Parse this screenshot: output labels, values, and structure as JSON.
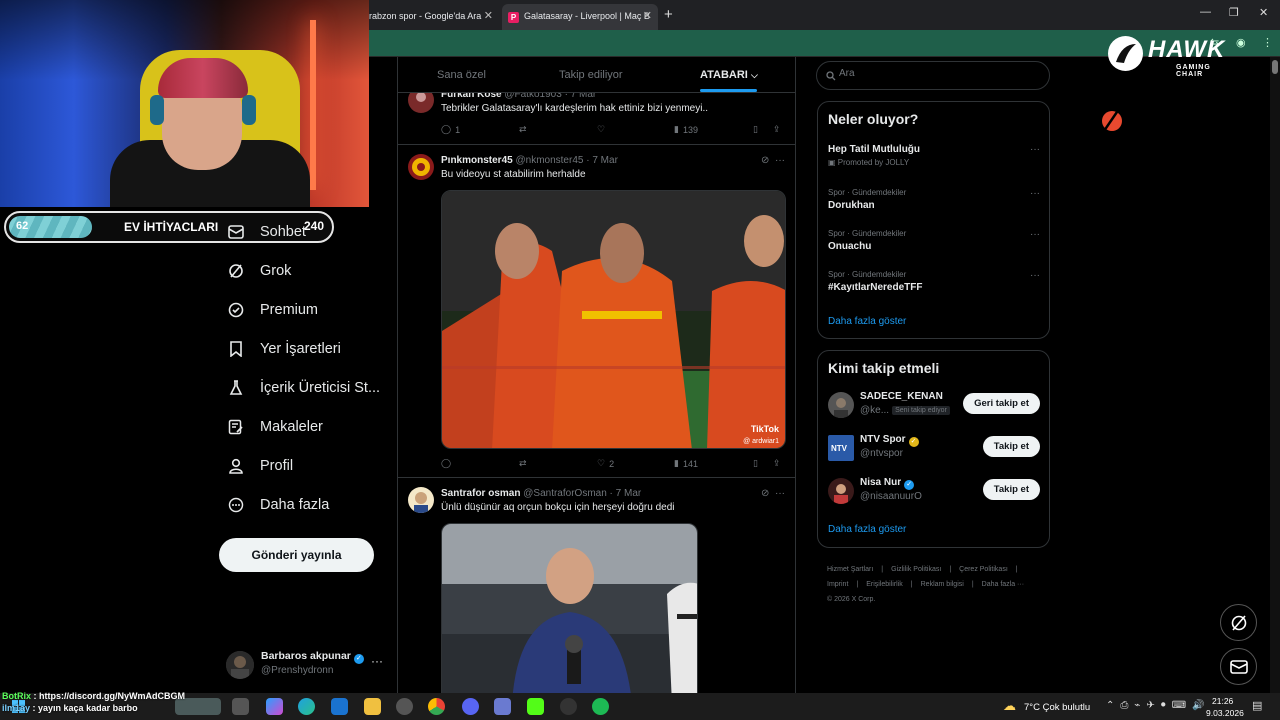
{
  "browser": {
    "tabs": [
      {
        "title": "rabzon spor - Google'da Ara",
        "active": false
      },
      {
        "title": "Galatasaray - Liverpool | Maç B",
        "active": true
      }
    ],
    "new_tab": "+",
    "win_min": "—",
    "win_max": "❐",
    "win_close": "✕"
  },
  "stream": {
    "need_bar": {
      "title": "EV İHTİYACLARI",
      "left_value": "62",
      "right_value": "240",
      "fill_fraction": 0.26
    },
    "chat": [
      {
        "user": "BotRix",
        "message": "https://discord.gg/NyWmAdCBGM"
      },
      {
        "user": "ilm1ay",
        "message": "yayın kaça kadar barbo"
      }
    ]
  },
  "nav": {
    "items": [
      {
        "name": "messages",
        "label": "Sohbet"
      },
      {
        "name": "grok",
        "label": "Grok"
      },
      {
        "name": "premium",
        "label": "Premium"
      },
      {
        "name": "bookmarks",
        "label": "Yer İşaretleri"
      },
      {
        "name": "creator-studio",
        "label": "İçerik Üreticisi St..."
      },
      {
        "name": "articles",
        "label": "Makaleler"
      },
      {
        "name": "profile",
        "label": "Profil"
      },
      {
        "name": "more",
        "label": "Daha fazla"
      }
    ],
    "post_button": "Gönderi yayınla",
    "account": {
      "name": "Barbaros akpunar",
      "handle": "@Prenshydronn",
      "more": "···"
    }
  },
  "feed": {
    "tabs": [
      {
        "label": "Sana özel",
        "active": false
      },
      {
        "label": "Takip ediliyor",
        "active": false
      },
      {
        "label": "ATABARI",
        "active": true
      }
    ],
    "tweets": [
      {
        "name": "Furkan Köse",
        "handle": "@Fatko1903",
        "date": "· 7 Mar",
        "text": "Tebrikler Galatasaray'lı kardeşlerim hak ettiniz bizi  yenmeyi..",
        "replies": "1",
        "retweets": "",
        "likes": "",
        "views": "139"
      },
      {
        "name": "Pınkmonster45",
        "handle": "@nkmonster45",
        "date": "· 7 Mar",
        "text": "Bu videoyu st atabilirim herhalde",
        "media_badge": "TikTok",
        "media_credit": "@ ardwiar1",
        "replies": "",
        "retweets": "",
        "likes": "2",
        "views": "141"
      },
      {
        "name": "Santrafor osman",
        "handle": "@SantraforOsman",
        "date": "· 7 Mar",
        "text": "Ünlü düşünür aq orçun bokçu için herşeyi doğru dedi"
      }
    ]
  },
  "right": {
    "search_placeholder": "Ara",
    "trends_title": "Neler oluyor?",
    "trends": [
      {
        "category": "Promoted by JOLLY",
        "title": "Hep Tatil Mutluluğu",
        "promoted": true
      },
      {
        "category": "Spor · Gündemdekiler",
        "title": "Dorukhan"
      },
      {
        "category": "Spor · Gündemdekiler",
        "title": "Onuachu"
      },
      {
        "category": "Spor · Gündemdekiler",
        "title": "#KayıtlarNeredeTFF"
      }
    ],
    "trends_more": "Daha fazla göster",
    "who_title": "Kimi takip etmeli",
    "who": [
      {
        "name": "SADECE_KENAN",
        "handle": "@ke...",
        "tag": "Seni takip ediyor",
        "button": "Geri takip et"
      },
      {
        "name": "NTV Spor",
        "handle": "@ntvspor",
        "badge": "gold",
        "button": "Takip et"
      },
      {
        "name": "Nisa Nur",
        "handle": "@nisaanuurO",
        "badge": "blue",
        "button": "Takip et"
      }
    ],
    "who_more": "Daha fazla göster",
    "footer": [
      "Hizmet Şartları",
      "|",
      "Gizlilik Politikası",
      "|",
      "Çerez Politikası",
      "|",
      "Imprint",
      "|",
      "Erişilebilirlik",
      "|",
      "Reklam bilgisi",
      "|",
      "Daha fazla ···",
      "© 2026 X Corp."
    ]
  },
  "brand": {
    "name": "HAWK",
    "subtitle": "GAMING CHAIR"
  },
  "taskbar": {
    "weather": "7°C  Çok bulutlu",
    "time": "21:26",
    "date": "9.03.2026"
  },
  "colors": {
    "accent": "#1d9bf0",
    "bg": "#000000",
    "border": "#2f3336",
    "muted": "#71767b"
  }
}
